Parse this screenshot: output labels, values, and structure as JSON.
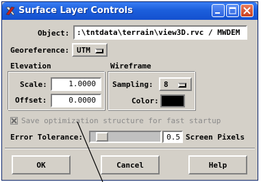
{
  "window": {
    "title": "Surface Layer Controls",
    "icon": "tnt-app-icon"
  },
  "object": {
    "label": "Object:",
    "value": ":\\tntdata\\terrain\\view3D.rvc / MWDEM"
  },
  "georeference": {
    "label": "Georeference:",
    "value": "UTM"
  },
  "elevation": {
    "title": "Elevation",
    "scale_label": "Scale:",
    "scale_value": "1.0000",
    "offset_label": "Offset:",
    "offset_value": "0.0000"
  },
  "wireframe": {
    "title": "Wireframe",
    "sampling_label": "Sampling:",
    "sampling_value": "8",
    "color_label": "Color:",
    "color": "#000000"
  },
  "optimization": {
    "label": "Save optimization structure for fast startup",
    "checked": true
  },
  "tolerance": {
    "label": "Error Tolerance:",
    "value": "0.5",
    "unit": "Screen Pixels"
  },
  "buttons": {
    "ok": "OK",
    "cancel": "Cancel",
    "help": "Help"
  },
  "colors": {
    "titlebar": "#1c5fdc",
    "dialog_bg": "#d4d0c8"
  }
}
